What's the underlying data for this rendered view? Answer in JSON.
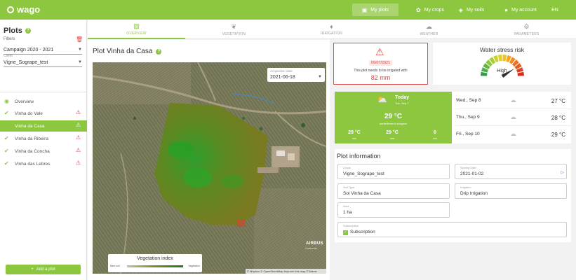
{
  "app": {
    "logo": "wago",
    "nav": [
      {
        "label": "My plots",
        "icon": "map-icon",
        "active": true
      },
      {
        "label": "My crops",
        "icon": "sprout-icon",
        "active": false
      },
      {
        "label": "My soils",
        "icon": "layers-icon",
        "active": false
      },
      {
        "label": "My account",
        "icon": "account-icon",
        "active": false
      },
      {
        "label": "EN",
        "icon": "",
        "active": false
      }
    ]
  },
  "sidebar": {
    "title": "Plots",
    "filters_label": "Filters",
    "campaign": {
      "value": "Campaign 2020 - 2021"
    },
    "client": {
      "caption": "Client",
      "value": "Vigne_Sogrape_test"
    },
    "overview_label": "Overview",
    "plots": [
      {
        "name": "Vinha do Vale",
        "active": false
      },
      {
        "name": "Vinha da Casa",
        "active": true
      },
      {
        "name": "Vinha da Ribeira",
        "active": false
      },
      {
        "name": "Vinha da Concha",
        "active": false
      },
      {
        "name": "Vinha das Lebres",
        "active": false
      }
    ],
    "add_button": "Add a plot"
  },
  "tabs": [
    {
      "label": "OVERVIEW",
      "icon": "image-icon",
      "active": true
    },
    {
      "label": "VEGETATION",
      "icon": "plant-icon",
      "active": false
    },
    {
      "label": "IRRIGATION",
      "icon": "water-drop-icon",
      "active": false
    },
    {
      "label": "WEATHER",
      "icon": "cloud-icon",
      "active": false
    },
    {
      "label": "PARAMETERS",
      "icon": "gear-icon",
      "active": false
    }
  ],
  "plot": {
    "title": "Plot Vinha da Casa",
    "acquisition": {
      "caption": "Acquisition date",
      "value": "2021-06-18"
    },
    "legend": {
      "title": "Vegetation index",
      "low": "Bare soil",
      "high": "Vegetation"
    },
    "airbus": "AIRBUS",
    "airbus_sub": "© Airbus DS",
    "attribution": "© Mapbox © OpenStreetMap Improve this map © Maxar"
  },
  "alert": {
    "date": "09/07/2021",
    "message": "This plot needs to be irrigated with",
    "amount": "82 mm"
  },
  "stress": {
    "title": "Water stress risk",
    "level_label": "High",
    "level_fraction": 0.82
  },
  "weather": {
    "today": {
      "label": "Today",
      "date": "Tue, Sep 7",
      "temp": "29 °C",
      "desc": "partiellement nuageux",
      "stats": [
        {
          "value": "29 °C",
          "label": "min"
        },
        {
          "value": "29 °C",
          "label": "max"
        },
        {
          "value": "0",
          "label": "mm"
        }
      ]
    },
    "forecast": [
      {
        "day": "Wed., Sep 8",
        "temp": "27 °C"
      },
      {
        "day": "Thu., Sep 9",
        "temp": "28 °C"
      },
      {
        "day": "Fri., Sep 10",
        "temp": "29 °C"
      }
    ]
  },
  "info": {
    "title": "Plot information",
    "crops": {
      "caption": "Crops",
      "value": "Vigne_Sogrape_test"
    },
    "sowing": {
      "caption": "Sowing Date",
      "value": "2021-01-02"
    },
    "soil": {
      "caption": "Soil Type",
      "value": "Sol Vinha da Casa"
    },
    "irrigation": {
      "caption": "Irrigation",
      "value": "Drip Irrigation"
    },
    "area": {
      "caption": "Area",
      "value": "1 ha"
    },
    "subscription": {
      "caption": "Subscription",
      "value": "Subscription"
    }
  },
  "colors": {
    "brand": "#8dc63f",
    "alert": "#e04040"
  }
}
